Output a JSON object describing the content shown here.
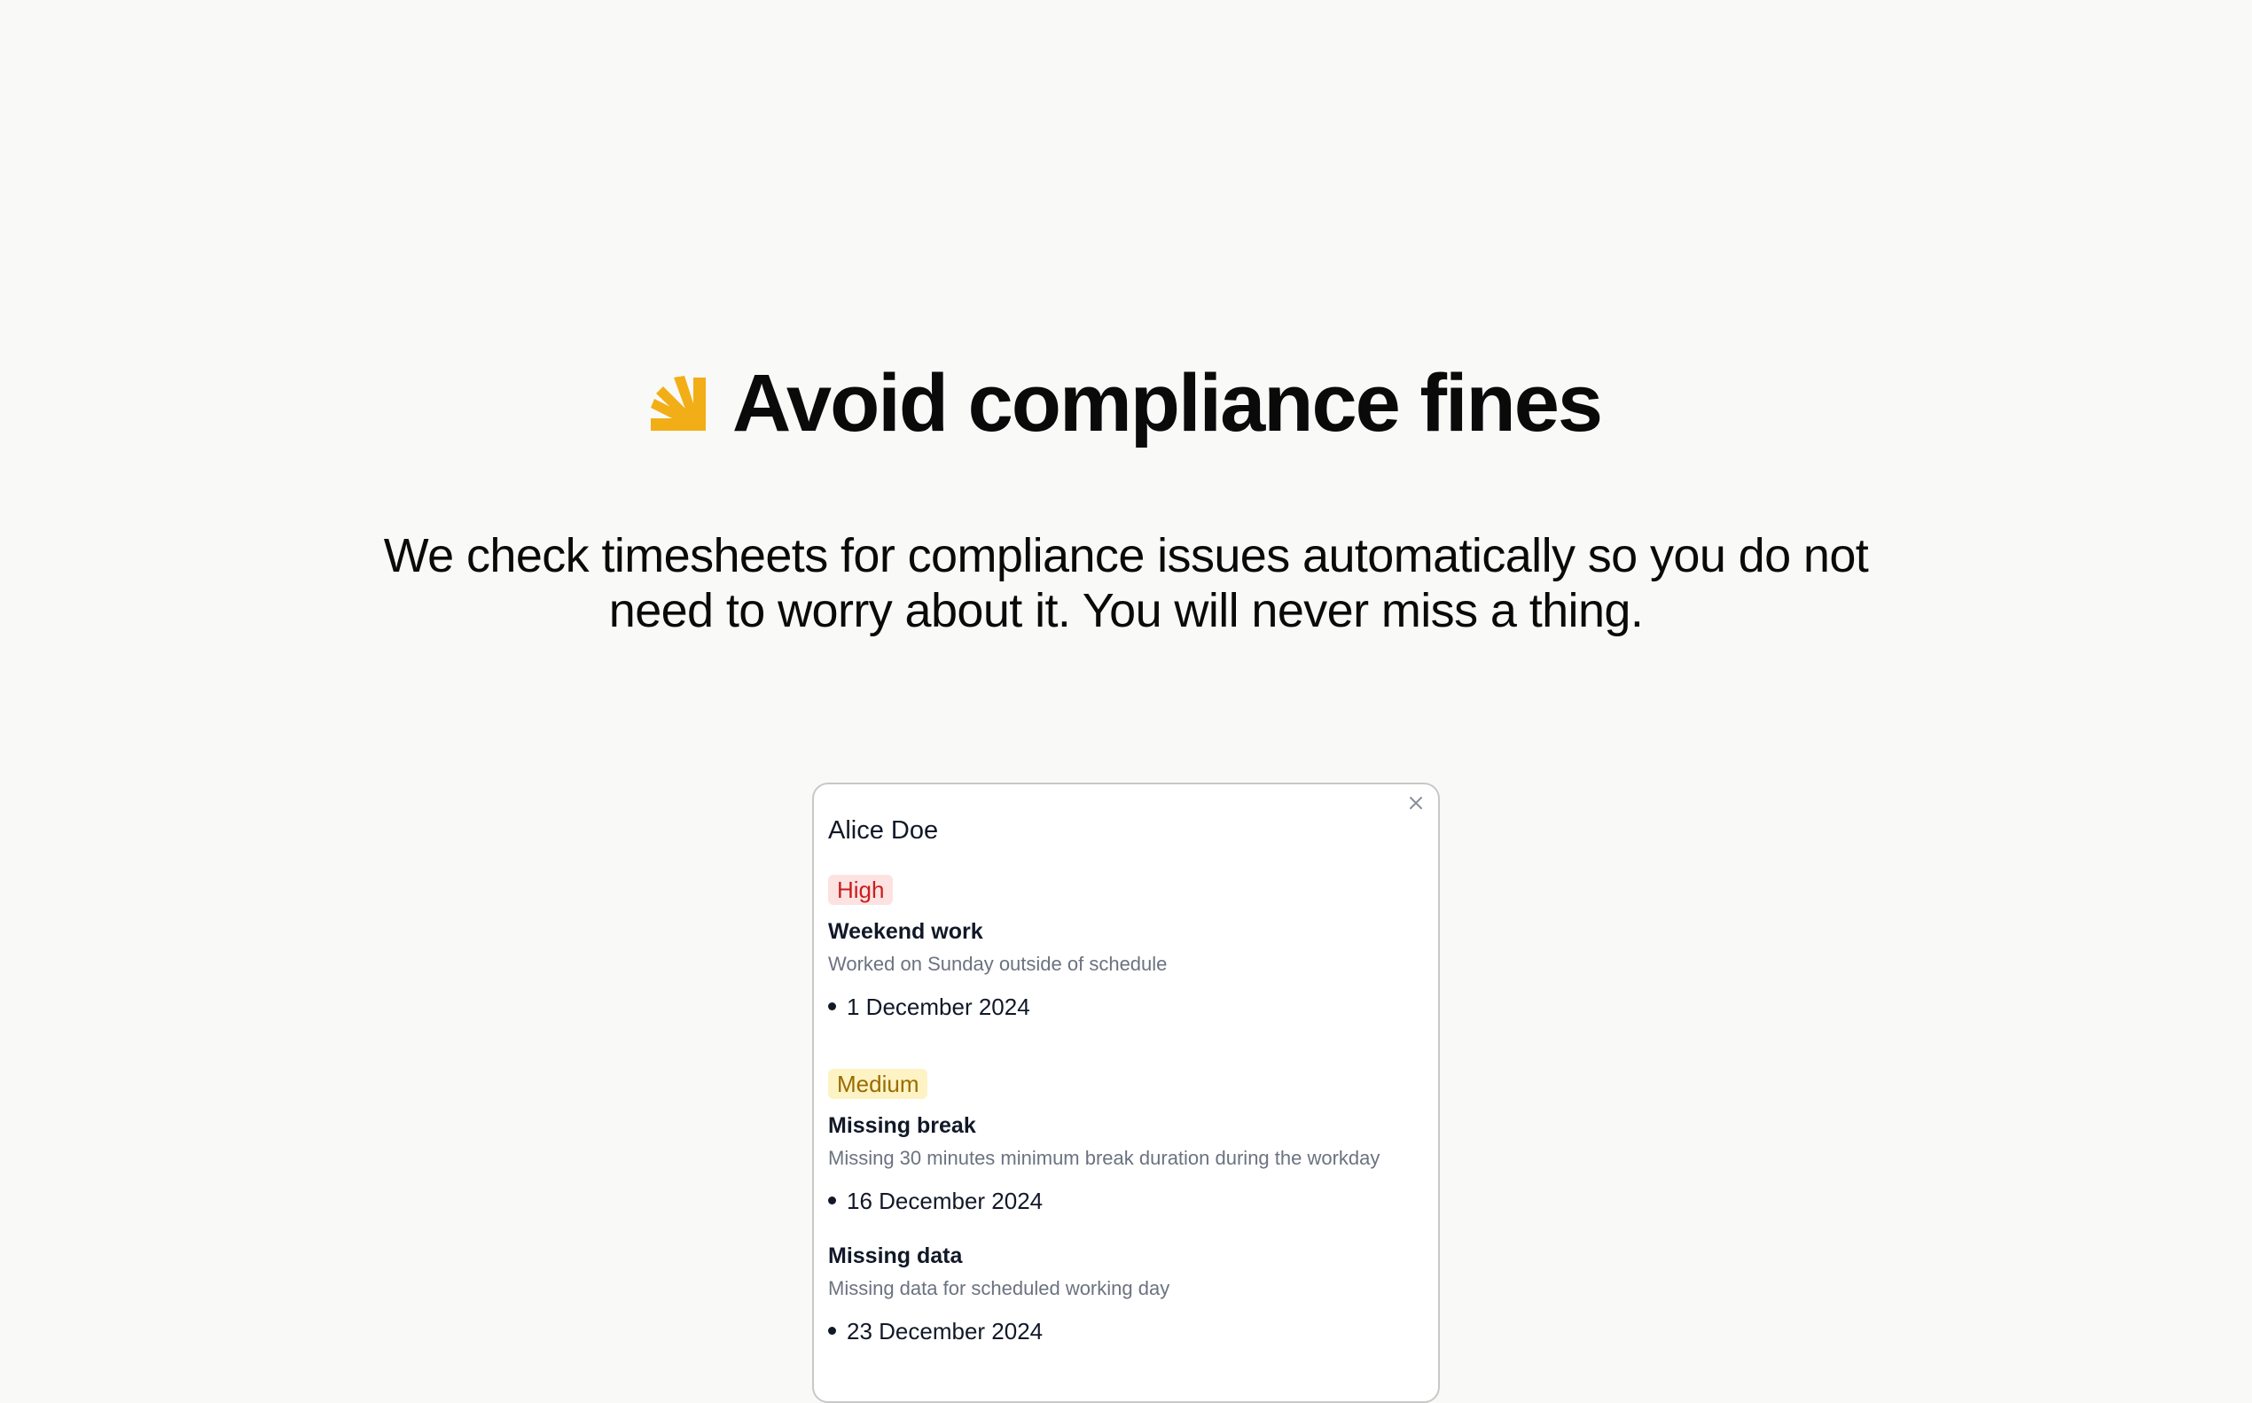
{
  "hero": {
    "title": "Avoid compliance fines",
    "subtitle": "We check timesheets for compliance issues automatically so you do not need to worry about it. You will never miss a thing.",
    "logo_icon": "sunburst-icon",
    "accent_color": "#f2ae17"
  },
  "card": {
    "name": "Alice Doe",
    "close_icon": "close-icon",
    "groups": [
      {
        "severity": "High",
        "severity_color": "#c81e1e",
        "issues": [
          {
            "title": "Weekend work",
            "description": "Worked on Sunday outside of schedule",
            "date": "1 December 2024"
          }
        ]
      },
      {
        "severity": "Medium",
        "severity_color": "#9a6b00",
        "issues": [
          {
            "title": "Missing break",
            "description": "Missing 30 minutes minimum break duration during the workday",
            "date": "16 December 2024"
          },
          {
            "title": "Missing data",
            "description": "Missing data for scheduled working day",
            "date": "23 December 2024"
          }
        ]
      }
    ]
  }
}
